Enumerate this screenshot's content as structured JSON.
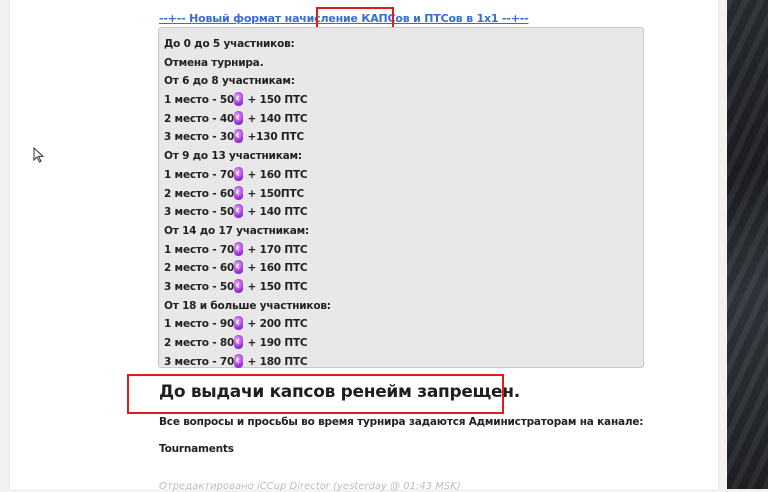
{
  "post": {
    "title": "--+-- Новый формат начисление КАПСов и ПТСов в 1х1 --+--",
    "quote_lines": [
      {
        "text": "До 0 до 5 участников:"
      },
      {
        "text": "Отмена турнира."
      },
      {
        "text": "От 6 до 8 участникам:"
      },
      {
        "before": "1 место - 50",
        "after": " + 150 ПТС",
        "icon": "currency-icon"
      },
      {
        "before": "2 место - 40",
        "after": " + 140 ПТС",
        "icon": "currency-icon"
      },
      {
        "before": "3 место - 30",
        "after": " +130 ПТС",
        "icon": "currency-icon"
      },
      {
        "text": "От 9 до 13 участникам:"
      },
      {
        "before": "1 место - 70",
        "after": " + 160 ПТС",
        "icon": "currency-icon"
      },
      {
        "before": "2 место - 60",
        "after": " + 150ПТС",
        "icon": "currency-icon"
      },
      {
        "before": "3 место - 50",
        "after": " + 140 ПТС",
        "icon": "currency-icon"
      },
      {
        "text": "От 14 до 17 участникам:"
      },
      {
        "before": "1 место - 70",
        "after": " + 170 ПТС",
        "icon": "currency-icon"
      },
      {
        "before": "2 место - 60",
        "after": " + 160 ПТС",
        "icon": "currency-icon"
      },
      {
        "before": "3 место - 50",
        "after": " + 150 ПТС",
        "icon": "currency-icon"
      },
      {
        "text": "От 18 и больше участников:"
      },
      {
        "before": "1 место - 90",
        "after": " + 200 ПТС",
        "icon": "currency-icon"
      },
      {
        "before": "2 место - 80",
        "after": " + 190 ПТС",
        "icon": "currency-icon"
      },
      {
        "before": "3 место - 70",
        "after": " + 180 ПТС",
        "icon": "currency-icon"
      }
    ],
    "notice": "До выдачи капсов ренейм запрещен.",
    "questions_text": "Все вопросы и просьбы во время турнира задаются Администраторам на канале:",
    "channel": "Tournaments",
    "edited_note": "Отредактировано iCCup Director (yesterday @ 01:43 MSK)"
  },
  "colors": {
    "link": "#3a6bd6",
    "highlight_box": "#e01b1b",
    "quote_bg": "#e8e8e8"
  }
}
